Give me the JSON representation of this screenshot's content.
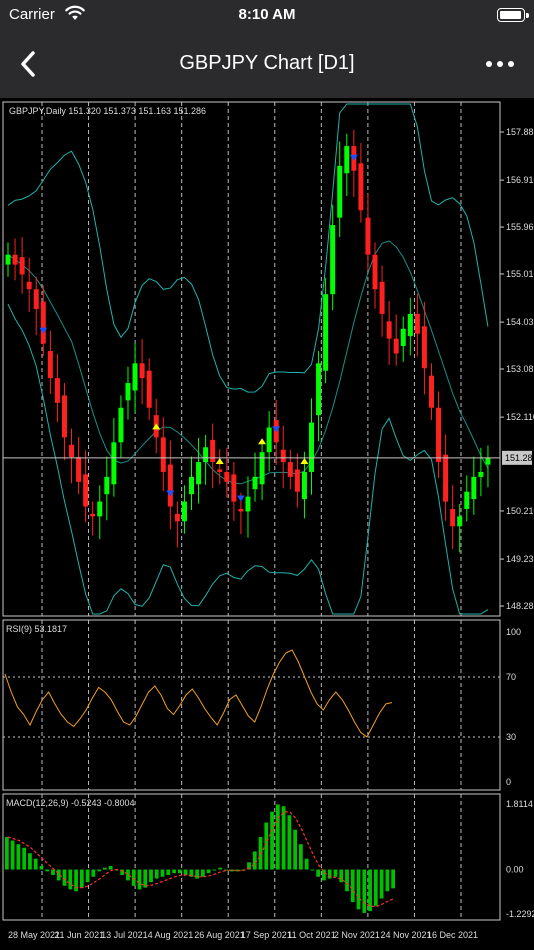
{
  "status_bar": {
    "carrier": "Carrier",
    "time": "8:10 AM"
  },
  "nav": {
    "title": "GBPJPY Chart [D1]"
  },
  "colors": {
    "bar_background": "#2b2b2d",
    "bull_candle": "#00ff00",
    "bear_candle": "#ff2020",
    "bands": "#20b2aa",
    "rsi_line": "#f0a020",
    "macd_signal": "#ff3030",
    "macd_hist": "#00c000",
    "arrow_up": "#ffff00",
    "arrow_down": "#1e50ff"
  },
  "chart_data": [
    {
      "type": "candlestick",
      "title": "GBPJPY,Daily 151.320 151.373 151.163 151.286",
      "y_ticks": [
        "157.885",
        "156.910",
        "155.960",
        "155.010",
        "154.035",
        "153.085",
        "152.110",
        "151.286",
        "150.210",
        "149.235",
        "148.285"
      ],
      "ylim": [
        148.285,
        157.885
      ],
      "current_price": 151.286,
      "indicators": [
        "Bollinger Bands"
      ],
      "x_labels": [
        "28 May 2021",
        "21 Jun 2021",
        "13 Jul 2021",
        "4 Aug 2021",
        "26 Aug 2021",
        "17 Sep 2021",
        "11 Oct 2021",
        "2 Nov 2021",
        "24 Nov 2021",
        "16 Dec 2021"
      ],
      "close_trend": [
        155.4,
        155.2,
        155.0,
        154.7,
        154.3,
        153.6,
        152.9,
        152.4,
        151.7,
        151.3,
        150.8,
        150.3,
        150.1,
        150.4,
        150.9,
        151.6,
        152.3,
        152.8,
        153.2,
        152.9,
        152.3,
        151.7,
        151.0,
        150.3,
        150.0,
        150.4,
        150.9,
        151.2,
        151.5,
        151.2,
        151.0,
        150.8,
        150.4,
        150.2,
        150.5,
        150.9,
        151.4,
        151.9,
        151.6,
        151.2,
        150.9,
        150.6,
        151.0,
        152.0,
        153.2,
        154.6,
        156.0,
        157.2,
        157.6,
        157.1,
        156.3,
        155.4,
        154.7,
        154.2,
        153.7,
        153.4,
        153.9,
        154.2,
        153.8,
        153.1,
        152.3,
        151.2,
        150.4,
        149.9,
        150.1,
        150.6,
        150.9,
        151.0,
        151.286
      ]
    },
    {
      "type": "line",
      "title": "RSI(9) 53.1817",
      "y_ticks": [
        "100",
        "70",
        "30",
        "0"
      ],
      "ylim": [
        0,
        100
      ],
      "levels": [
        70,
        30
      ],
      "values": [
        72,
        60,
        50,
        45,
        38,
        47,
        55,
        60,
        52,
        45,
        40,
        37,
        42,
        48,
        56,
        63,
        60,
        55,
        47,
        40,
        38,
        44,
        52,
        60,
        64,
        58,
        49,
        45,
        51,
        58,
        62,
        56,
        49,
        43,
        38,
        46,
        55,
        58,
        51,
        44,
        40,
        50,
        62,
        72,
        80,
        86,
        88,
        80,
        70,
        60,
        52,
        48,
        55,
        60,
        55,
        48,
        40,
        33,
        30,
        38,
        46,
        52,
        53
      ]
    },
    {
      "type": "bar",
      "title": "MACD(12,26,9) -0.5243 -0.8004",
      "y_ticks": [
        "1.8114",
        "0.00",
        "-1.2292"
      ],
      "ylim": [
        -1.2292,
        1.8114
      ],
      "values": [
        0.9,
        0.8,
        0.7,
        0.6,
        0.45,
        0.3,
        0.1,
        -0.05,
        -0.15,
        -0.3,
        -0.45,
        -0.55,
        -0.6,
        -0.5,
        -0.35,
        -0.2,
        -0.05,
        0.05,
        0.1,
        0.0,
        -0.15,
        -0.3,
        -0.45,
        -0.55,
        -0.5,
        -0.35,
        -0.25,
        -0.2,
        -0.15,
        -0.1,
        -0.1,
        -0.15,
        -0.2,
        -0.25,
        -0.2,
        -0.1,
        0.0,
        0.05,
        0.0,
        -0.05,
        -0.05,
        0.0,
        0.2,
        0.5,
        0.9,
        1.3,
        1.6,
        1.8,
        1.75,
        1.5,
        1.1,
        0.7,
        0.3,
        0.0,
        -0.2,
        -0.3,
        -0.25,
        -0.2,
        -0.35,
        -0.6,
        -0.9,
        -1.1,
        -1.2,
        -1.15,
        -1.0,
        -0.8,
        -0.6,
        -0.52
      ],
      "signal": [
        0.9,
        0.85,
        0.8,
        0.7,
        0.6,
        0.45,
        0.3,
        0.15,
        0.0,
        -0.15,
        -0.3,
        -0.42,
        -0.5,
        -0.5,
        -0.45,
        -0.35,
        -0.25,
        -0.12,
        -0.02,
        0.0,
        -0.05,
        -0.15,
        -0.28,
        -0.4,
        -0.45,
        -0.43,
        -0.38,
        -0.32,
        -0.26,
        -0.2,
        -0.16,
        -0.15,
        -0.17,
        -0.2,
        -0.2,
        -0.17,
        -0.12,
        -0.06,
        -0.02,
        -0.02,
        -0.03,
        -0.02,
        0.05,
        0.2,
        0.45,
        0.8,
        1.15,
        1.45,
        1.6,
        1.58,
        1.4,
        1.1,
        0.75,
        0.4,
        0.1,
        -0.1,
        -0.2,
        -0.22,
        -0.28,
        -0.4,
        -0.6,
        -0.8,
        -0.95,
        -1.02,
        -1.02,
        -0.95,
        -0.87,
        -0.8
      ]
    }
  ]
}
